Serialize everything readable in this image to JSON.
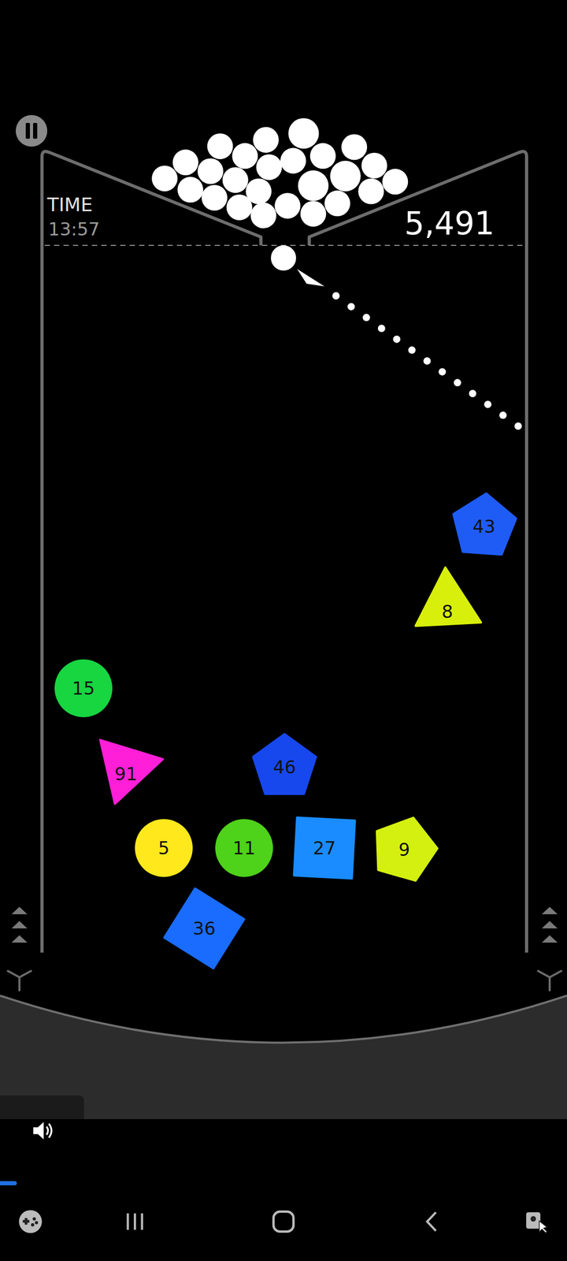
{
  "hud": {
    "time_label": "TIME",
    "time": "13:57",
    "score": "5,491"
  },
  "shapes": [
    {
      "value": "43",
      "kind": "pentagon",
      "color": "#1f5cf6"
    },
    {
      "value": "8",
      "kind": "triangle",
      "color": "#d8ef0c"
    },
    {
      "value": "15",
      "kind": "circle",
      "color": "#17d640"
    },
    {
      "value": "91",
      "kind": "triangle",
      "color": "#ff1fd8"
    },
    {
      "value": "46",
      "kind": "pentagon",
      "color": "#1748ee"
    },
    {
      "value": "5",
      "kind": "circle",
      "color": "#ffe81c"
    },
    {
      "value": "11",
      "kind": "circle",
      "color": "#4ed21a"
    },
    {
      "value": "27",
      "kind": "square",
      "color": "#1a8cff"
    },
    {
      "value": "9",
      "kind": "pentagon",
      "color": "#d4f010"
    },
    {
      "value": "36",
      "kind": "square",
      "color": "#1a6cff"
    }
  ],
  "video": {
    "level": 0.03
  }
}
